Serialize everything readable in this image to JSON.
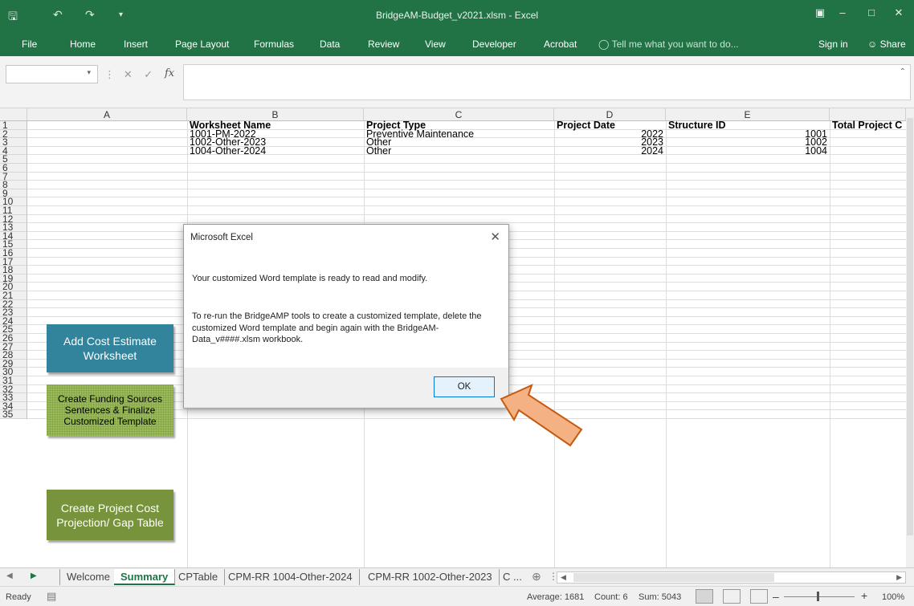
{
  "window": {
    "title": "BridgeAM-Budget_v2021.xlsm - Excel"
  },
  "ribbon": {
    "tabs": [
      "File",
      "Home",
      "Insert",
      "Page Layout",
      "Formulas",
      "Data",
      "Review",
      "View",
      "Developer",
      "Acrobat"
    ],
    "tell_me": "Tell me what you want to do...",
    "sign_in": "Sign in",
    "share": "Share"
  },
  "formula_bar": {
    "fx": "fx"
  },
  "columns": [
    "A",
    "B",
    "C",
    "D",
    "E"
  ],
  "rows": [
    "1",
    "2",
    "3",
    "4",
    "5",
    "6",
    "7",
    "8",
    "9",
    "10",
    "11",
    "12",
    "13",
    "14",
    "15",
    "16",
    "17",
    "18",
    "19",
    "20",
    "21",
    "22",
    "23",
    "24",
    "25",
    "26",
    "27",
    "28",
    "29",
    "30",
    "31",
    "32",
    "33",
    "34",
    "35"
  ],
  "table": {
    "headers": [
      "Worksheet Name",
      "Project Type",
      "Project Date",
      "Structure ID",
      "Total Project C"
    ],
    "rows": [
      {
        "worksheet": "1001-PM-2022",
        "type": "Preventive Maintenance",
        "date": "2022",
        "structure": "1001"
      },
      {
        "worksheet": "1002-Other-2023",
        "type": "Other",
        "date": "2023",
        "structure": "1002"
      },
      {
        "worksheet": "1004-Other-2024",
        "type": "Other",
        "date": "2024",
        "structure": "1004"
      }
    ]
  },
  "buttons": {
    "add_cost": "Add Cost Estimate Worksheet",
    "funding": "Create Funding Sources Sentences & Finalize Customized Template",
    "projection": "Create Project Cost Projection/ Gap Table"
  },
  "dialog": {
    "title": "Microsoft Excel",
    "message1": "Your customized Word template is ready to read and modify.",
    "message2": "To re-run the BridgeAMP tools to create a customized template, delete the customized Word template and begin again with the BridgeAM-Data_v####.xlsm workbook.",
    "ok": "OK"
  },
  "sheet_tabs": [
    "Welcome",
    "Summary",
    "CPTable",
    "CPM-RR  1004-Other-2024",
    "CPM-RR  1002-Other-2023",
    "C ..."
  ],
  "active_sheet": "Summary",
  "status": {
    "ready": "Ready",
    "average": "Average: 1681",
    "count": "Count: 6",
    "sum": "Sum: 5043",
    "zoom": "100%"
  },
  "colors": {
    "excel_green": "#217346",
    "button_teal": "#31849b",
    "button_light_green": "#9bbb59",
    "button_olive": "#77933c",
    "arrow_fill": "#f4b183",
    "arrow_stroke": "#c55a11"
  }
}
